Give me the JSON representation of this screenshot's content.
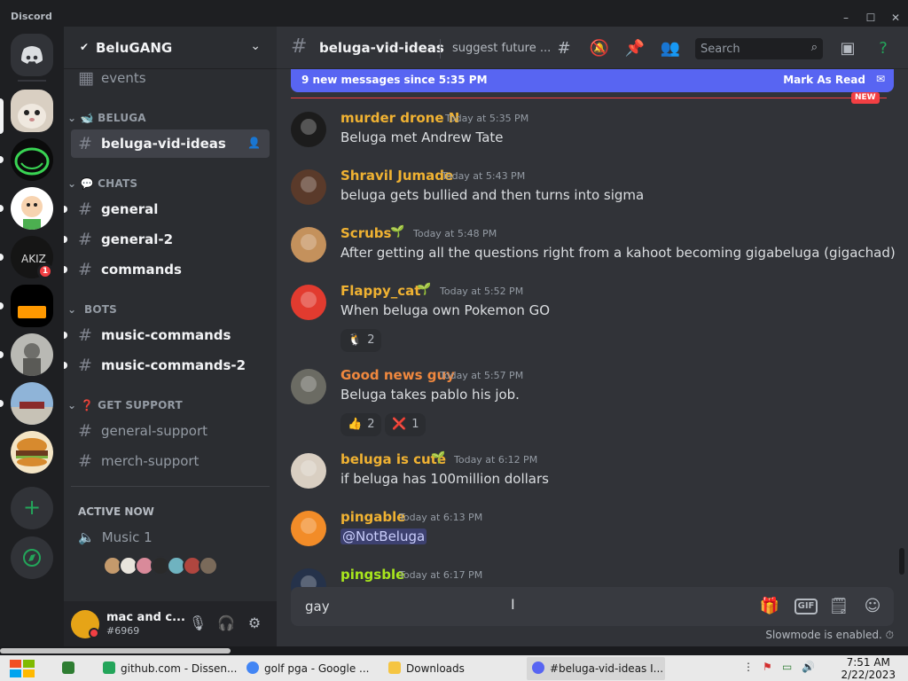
{
  "window": {
    "app_title": "Discord",
    "minimize": "–",
    "maximize": "☐",
    "close": "✕"
  },
  "rail": {
    "badge_count": "1"
  },
  "guild": {
    "name": "BeluGANG",
    "check": "✔",
    "chevron": "⌄"
  },
  "channels": {
    "events": "events",
    "category_beluga": "BELUGA",
    "beluga_vid_ideas": "beluga-vid-ideas",
    "category_chats": "CHATS",
    "general": "general",
    "general_2": "general-2",
    "commands": "commands",
    "category_bots": "BOTS",
    "music_commands": "music-commands",
    "music_commands_2": "music-commands-2",
    "category_support": "GET SUPPORT",
    "general_support": "general-support",
    "merch_support": "merch-support",
    "hash": "#"
  },
  "active_now": {
    "title": "ACTIVE NOW",
    "voice_channel": "Music 1"
  },
  "user": {
    "name": "mac and c...",
    "tag": "#6969"
  },
  "header": {
    "channel": "beluga-vid-ideas",
    "topic": "suggest future ...",
    "search_placeholder": "Search"
  },
  "new_messages": {
    "text": "9 new messages since 5:35 PM",
    "mark_read": "Mark As Read",
    "tag": "NEW"
  },
  "messages": [
    {
      "author": "murder drone N",
      "color": "#f0b232",
      "time": "Today at 5:35 PM",
      "text": "Beluga met Andrew Tate"
    },
    {
      "author": "Shravil Jumade",
      "color": "#f0b232",
      "time": "Today at 5:43 PM",
      "text": "beluga gets bullied and then turns into sigma"
    },
    {
      "author": "Scrubs",
      "color": "#f0b232",
      "time": "Today at 5:48 PM",
      "text": "After getting all the questions right from a kahoot becoming gigabeluga (gigachad)"
    },
    {
      "author": "Flappy_cat",
      "color": "#f0b232",
      "time": "Today at 5:52 PM",
      "text": "When beluga own Pokemon GO",
      "reactions": [
        {
          "emoji": "🐧",
          "count": "2"
        }
      ]
    },
    {
      "author": "Good news guy",
      "color": "#f0883e",
      "time": "Today at 5:57 PM",
      "text": "Beluga takes pablo his job.",
      "reactions": [
        {
          "emoji": "👍",
          "count": "2"
        },
        {
          "emoji": "❌",
          "count": "1"
        }
      ]
    },
    {
      "author": "beluga is cute",
      "color": "#f0b232",
      "time": "Today at 6:12 PM",
      "text": "if beluga has 100million dollars"
    },
    {
      "author": "pingable",
      "color": "#f0b232",
      "time": "Today at 6:13 PM",
      "text": "@NotBeluga"
    },
    {
      "author": "pingsble",
      "color": "#a8e61d",
      "time": "Today at 6:17 PM",
      "text": ""
    }
  ],
  "composer": {
    "value": "gay",
    "slowmode": "Slowmode is enabled."
  },
  "taskbar": {
    "items": [
      {
        "label": "github.com - Dissen..."
      },
      {
        "label": "golf pga - Google ..."
      },
      {
        "label": "Downloads"
      },
      {
        "label": "#beluga-vid-ideas I..."
      }
    ],
    "time": "7:51 AM",
    "date": "2/22/2023"
  },
  "colors": {
    "accent": "#5865f2",
    "alert": "#f23f43",
    "online_green": "#23a55a"
  }
}
